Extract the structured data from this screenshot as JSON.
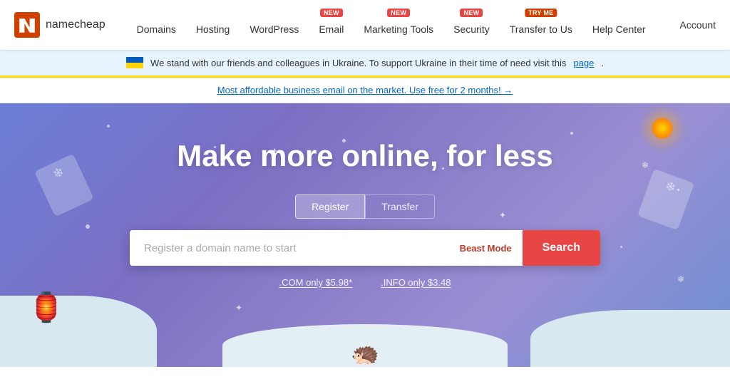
{
  "logo": {
    "text": "namecheap",
    "alt": "Namecheap logo"
  },
  "nav": {
    "items": [
      {
        "id": "domains",
        "label": "Domains",
        "badge": null
      },
      {
        "id": "hosting",
        "label": "Hosting",
        "badge": null
      },
      {
        "id": "wordpress",
        "label": "WordPress",
        "badge": null
      },
      {
        "id": "email",
        "label": "Email",
        "badge": "NEW"
      },
      {
        "id": "marketing-tools",
        "label": "Marketing Tools",
        "badge": "NEW"
      },
      {
        "id": "security",
        "label": "Security",
        "badge": "NEW"
      },
      {
        "id": "transfer",
        "label": "Transfer to Us",
        "badge": "TRY ME"
      },
      {
        "id": "help-center",
        "label": "Help Center",
        "badge": null
      }
    ],
    "account_label": "Account"
  },
  "ukraine_banner": {
    "text": "We stand with our friends and colleagues in Ukraine. To support Ukraine in their time of need visit this",
    "link_text": "page",
    "link": "#"
  },
  "promo_banner": {
    "text": "Most affordable business email on the market. Use free for 2 months! →",
    "link": "#"
  },
  "hero": {
    "title": "Make more online, for less",
    "tabs": [
      {
        "id": "register",
        "label": "Register",
        "active": true
      },
      {
        "id": "transfer",
        "label": "Transfer",
        "active": false
      }
    ],
    "search_placeholder": "Register a domain name to start",
    "beast_mode_label": "Beast Mode",
    "search_button_label": "Search",
    "price_hints": [
      {
        "text": ".COM only $5.98*"
      },
      {
        "text": ".INFO only $3.48"
      }
    ]
  }
}
